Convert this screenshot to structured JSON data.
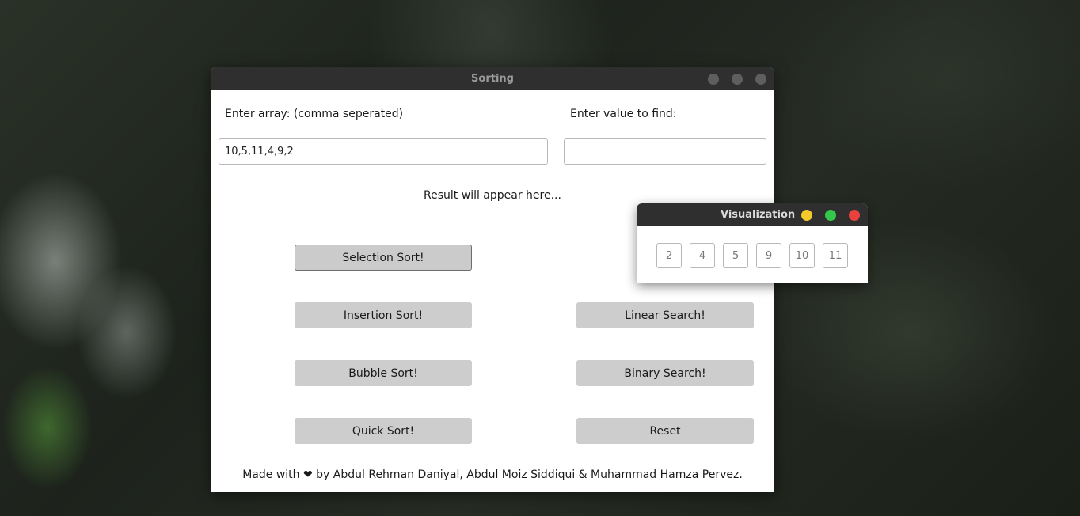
{
  "window": {
    "title": "Sorting",
    "array_label": "Enter array: (comma seperated)",
    "array_value": "10,5,11,4,9,2",
    "find_label": "Enter value to find:",
    "find_value": "",
    "result_text": "Result will appear here...",
    "buttons": {
      "selection": "Selection Sort!",
      "insertion": "Insertion Sort!",
      "bubble": "Bubble Sort!",
      "quick": "Quick Sort!",
      "linear": "Linear Search!",
      "binary": "Binary Search!",
      "reset": "Reset"
    },
    "footer": "Made with ❤ by Abdul Rehman Daniyal, Abdul Moiz Siddiqui & Muhammad Hamza Pervez."
  },
  "visualization": {
    "title": "Visualization",
    "cells": [
      "2",
      "4",
      "5",
      "9",
      "10",
      "11"
    ],
    "colors": {
      "minimize": "#f4c92b",
      "maximize": "#34c84a",
      "close": "#e9413d"
    }
  }
}
